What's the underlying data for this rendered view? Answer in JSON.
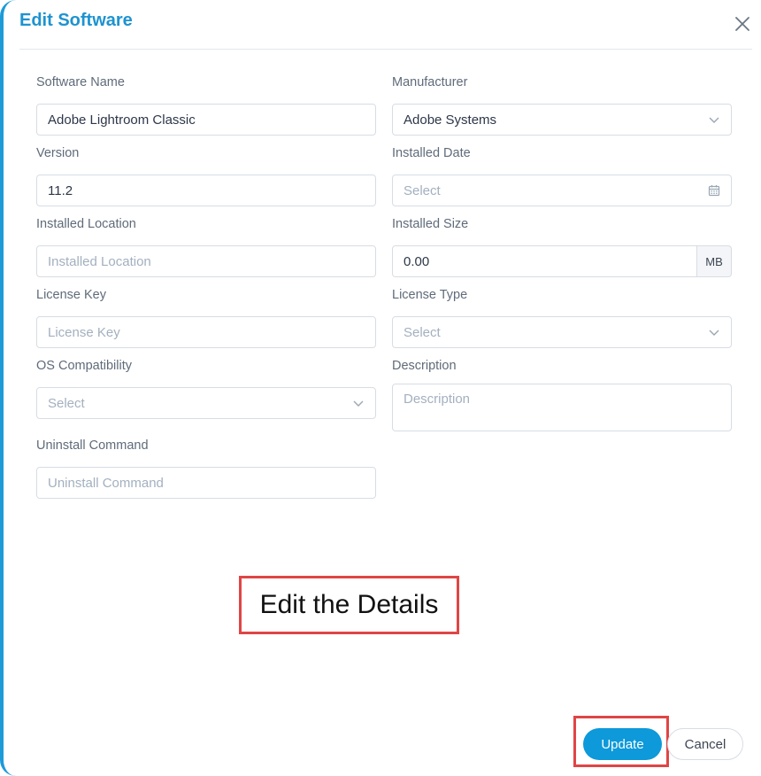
{
  "dialog": {
    "title": "Edit Software",
    "close_icon": "close-icon"
  },
  "form": {
    "software_name": {
      "label": "Software Name",
      "value": "Adobe Lightroom Classic"
    },
    "manufacturer": {
      "label": "Manufacturer",
      "value": "Adobe Systems",
      "icon": "chevron-down-icon"
    },
    "version": {
      "label": "Version",
      "value": "11.2"
    },
    "installed_date": {
      "label": "Installed Date",
      "placeholder": "Select",
      "icon": "calendar-icon"
    },
    "installed_location": {
      "label": "Installed Location",
      "placeholder": "Installed Location"
    },
    "installed_size": {
      "label": "Installed Size",
      "value": "0.00",
      "unit": "MB"
    },
    "license_key": {
      "label": "License Key",
      "placeholder": "License Key"
    },
    "license_type": {
      "label": "License Type",
      "placeholder": "Select",
      "icon": "chevron-down-icon"
    },
    "os_compatibility": {
      "label": "OS Compatibility",
      "placeholder": "Select",
      "icon": "chevron-down-icon"
    },
    "description": {
      "label": "Description",
      "placeholder": "Description"
    },
    "uninstall_command": {
      "label": "Uninstall Command",
      "placeholder": "Uninstall Command"
    }
  },
  "annotation": {
    "text": "Edit the Details",
    "color": "#e04545"
  },
  "footer": {
    "update_label": "Update",
    "cancel_label": "Cancel"
  },
  "colors": {
    "accent": "#0d99da",
    "title": "#1d93d0",
    "highlight": "#e04545"
  }
}
